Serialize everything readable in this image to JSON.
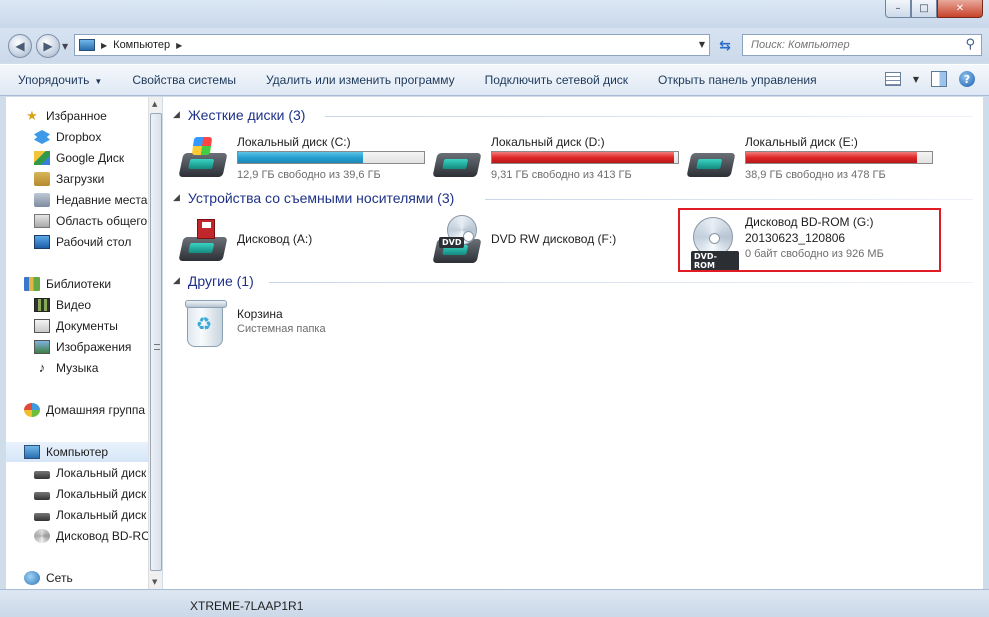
{
  "window": {
    "controls": {
      "minimize": "–",
      "maximize": "□",
      "close": "✕"
    }
  },
  "address": {
    "crumb": "Компьютер",
    "search_placeholder": "Поиск: Компьютер"
  },
  "toolbar": {
    "organize": "Упорядочить",
    "system_properties": "Свойства системы",
    "uninstall": "Удалить или изменить программу",
    "map_drive": "Подключить сетевой диск",
    "control_panel": "Открыть панель управления"
  },
  "nav": {
    "favorites": "Избранное",
    "dropbox": "Dropbox",
    "gdrive": "Google Диск",
    "downloads": "Загрузки",
    "recent": "Недавние места",
    "shared_area": "Область общего",
    "desktop": "Рабочий стол",
    "libraries": "Библиотеки",
    "video": "Видео",
    "documents": "Документы",
    "images": "Изображения",
    "music": "Музыка",
    "homegroup": "Домашняя группа",
    "computer": "Компьютер",
    "local_c": "Локальный диск",
    "local_d": "Локальный диск",
    "local_e": "Локальный диск",
    "bd_rom": "Дисковод BD-ROM",
    "network": "Сеть"
  },
  "groups": {
    "hard_drives": "Жесткие диски (3)",
    "removable": "Устройства со съемными носителями (3)",
    "other": "Другие (1)"
  },
  "drives": {
    "c": {
      "name": "Локальный диск (C:)",
      "free": "12,9 ГБ свободно из 39,6 ГБ",
      "used_fraction": 0.674
    },
    "d": {
      "name": "Локальный диск (D:)",
      "free": "9,31 ГБ свободно из 413 ГБ",
      "used_fraction": 0.977
    },
    "e": {
      "name": "Локальный диск (E:)",
      "free": "38,9 ГБ свободно из 478 ГБ",
      "used_fraction": 0.919
    }
  },
  "devices": {
    "floppy": {
      "name": "Дисковод (A:)"
    },
    "dvd": {
      "name": "DVD RW дисковод (F:)",
      "icon_label": "DVD"
    },
    "bd": {
      "name": "Дисковод BD-ROM (G:)",
      "label": "20130623_120806",
      "free": "0 байт свободно из 926 МБ",
      "icon_label": "DVD-ROM"
    }
  },
  "other": {
    "recycle": {
      "name": "Корзина",
      "type": "Системная папка"
    }
  },
  "status": {
    "computer_name": "XTREME-7LAAP1R1"
  },
  "colors": {
    "bar_ok": "#26a0d0",
    "bar_full": "#e02727",
    "highlight": "#e01b24",
    "group_title": "#1e3287"
  }
}
